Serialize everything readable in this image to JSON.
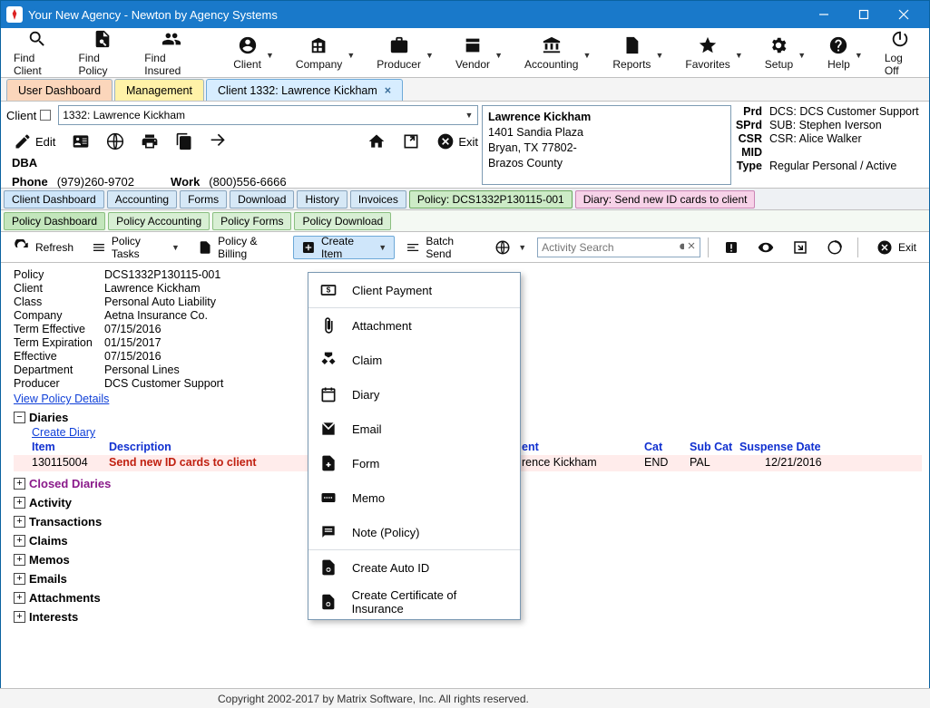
{
  "window": {
    "title": "Your New Agency -  Newton by Agency Systems"
  },
  "mainToolbar": {
    "findClient": "Find Client",
    "findPolicy": "Find Policy",
    "findInsured": "Find Insured",
    "client": "Client",
    "company": "Company",
    "producer": "Producer",
    "vendor": "Vendor",
    "accounting": "Accounting",
    "reports": "Reports",
    "favorites": "Favorites",
    "setup": "Setup",
    "help": "Help",
    "logoff": "Log Off"
  },
  "tabs": {
    "userDashboard": "User Dashboard",
    "management": "Management",
    "client": "Client   1332: Lawrence Kickham"
  },
  "clientHeader": {
    "label": "Client",
    "comboValue": "1332: Lawrence Kickham",
    "editLabel": "Edit",
    "exitLabel": "Exit",
    "dba": "DBA",
    "phoneLabel": "Phone",
    "phone": "(979)260-9702",
    "workLabel": "Work",
    "work": "(800)556-6666"
  },
  "infoBox": {
    "name": "Lawrence Kickham",
    "addr1": "1401 Sandia Plaza",
    "addr2": "Bryan, TX 77802-",
    "addr3": "Brazos County"
  },
  "rightGrid": {
    "prdK": "Prd",
    "prdV": "DCS: DCS Customer Support",
    "sprdK": "SPrd",
    "sprdV": "SUB: Stephen Iverson",
    "csrK": "CSR",
    "csrV": "CSR: Alice Walker",
    "midK": "MID",
    "midV": "",
    "typeK": "Type",
    "typeV": "Regular Personal / Active"
  },
  "subTabs": {
    "clientDashboard": "Client Dashboard",
    "accounting": "Accounting",
    "forms": "Forms",
    "download": "Download",
    "history": "History",
    "invoices": "Invoices",
    "policy": "Policy: DCS1332P130115-001",
    "diary": "Diary: Send new ID cards to client"
  },
  "polSubTabs": {
    "policyDashboard": "Policy Dashboard",
    "policyAccounting": "Policy Accounting",
    "policyForms": "Policy Forms",
    "policyDownload": "Policy Download"
  },
  "actionBar": {
    "refresh": "Refresh",
    "policyTasks": "Policy Tasks",
    "policyBilling": "Policy & Billing",
    "createItem": "Create Item",
    "batchSend": "Batch Send",
    "searchPlaceholder": "Activity Search",
    "exit": "Exit"
  },
  "fields": {
    "policyK": "Policy",
    "policyV": "DCS1332P130115-001",
    "clientK": "Client",
    "clientV": "Lawrence Kickham",
    "classK": "Class",
    "classV": "Personal Auto Liability",
    "companyK": "Company",
    "companyV": "Aetna Insurance Co.",
    "teffK": "Term Effective",
    "teffV": "07/15/2016",
    "texpK": "Term Expiration",
    "texpV": "01/15/2017",
    "effK": "Effective",
    "effV": "07/15/2016",
    "deptK": "Department",
    "deptV": "Personal Lines",
    "prodK": "Producer",
    "prodV": "DCS Customer Support",
    "viewPolicy": "View Policy Details"
  },
  "diaries": {
    "title": "Diaries",
    "create": "Create Diary",
    "colItem": "Item",
    "colDesc": "Description",
    "colClient": "ent",
    "colCat": "Cat",
    "colSub": "Sub Cat",
    "colSusp": "Suspense Date",
    "rowItem": "130115004",
    "rowDesc": "Send new ID cards to client",
    "rowClient": "rence Kickham",
    "rowCat": "END",
    "rowSub": "PAL",
    "rowSusp": "12/21/2016",
    "closed": "Closed Diaries"
  },
  "sections": {
    "activity": "Activity",
    "transactions": "Transactions",
    "claims": "Claims",
    "memos": "Memos",
    "emails": "Emails",
    "attachments": "Attachments",
    "interests": "Interests"
  },
  "createMenu": {
    "clientPayment": "Client Payment",
    "attachment": "Attachment",
    "claim": "Claim",
    "diary": "Diary",
    "email": "Email",
    "form": "Form",
    "memo": "Memo",
    "note": "Note (Policy)",
    "autoId": "Create Auto ID",
    "certificate": "Create Certificate of Insurance"
  },
  "footer": "Copyright 2002-2017 by Matrix Software, Inc. All rights reserved."
}
